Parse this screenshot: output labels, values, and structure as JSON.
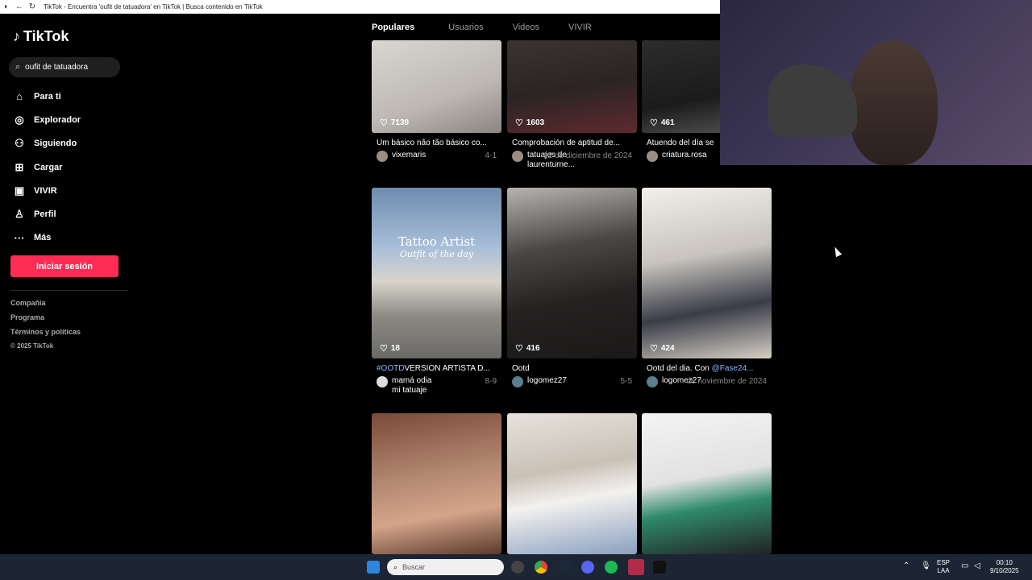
{
  "browser": {
    "title": "TikTok - Encuentra 'oufit de tatuadora' en TikTok | Busca contenido en TikTok"
  },
  "sidebar": {
    "logo": "TikTok",
    "search_value": "oufit de tatuadora",
    "items": [
      {
        "label": "Para ti",
        "icon": "home-icon"
      },
      {
        "label": "Explorador",
        "icon": "compass-icon"
      },
      {
        "label": "Siguiendo",
        "icon": "following-icon"
      },
      {
        "label": "Cargar",
        "icon": "upload-icon"
      },
      {
        "label": "VIVIR",
        "icon": "live-icon"
      },
      {
        "label": "Perfil",
        "icon": "profile-icon"
      },
      {
        "label": "Más",
        "icon": "more-icon"
      }
    ],
    "login_label": "Iniciar sesión",
    "footer": [
      "Compañía",
      "Programa",
      "Términos y políticas",
      "© 2025 TikTok"
    ]
  },
  "tabs": [
    {
      "label": "Populares",
      "active": true
    },
    {
      "label": "Usuarios",
      "active": false
    },
    {
      "label": "Videos",
      "active": false
    },
    {
      "label": "VIVIR",
      "active": false
    }
  ],
  "results": [
    {
      "likes": "7139",
      "caption": "Um básico não tão básico co...",
      "author": "vixemaris",
      "count": "4-1"
    },
    {
      "likes": "1603",
      "caption": "Comprobación de aptitud de...",
      "author": "tatuajes de laurenturne...",
      "date": "12 de diciembre de 2024"
    },
    {
      "likes": "461",
      "caption": "Atuendo del día se",
      "author": "criatura.rosa"
    },
    {
      "likes": "18",
      "hashtag": "#OOTD",
      "caption": "VERSIÓN ARTISTA D...",
      "author": "mamá odia mi tatuaje",
      "count": "8-9"
    },
    {
      "likes": "416",
      "caption": "Ootd",
      "author": "logomez27",
      "count": "5-5"
    },
    {
      "likes": "424",
      "caption": "Ootd del dia. Con ",
      "mention": "@Fase24...",
      "author": "logomez27",
      "date": "de noviembre de 2024"
    },
    {},
    {},
    {}
  ],
  "overlay_text": {
    "tattoo_title": "Tattoo Artist",
    "tattoo_sub": "Outfit of the day",
    "ootd": "OOTD"
  },
  "taskbar": {
    "search_placeholder": "Buscar",
    "lang_top": "ESP",
    "lang_bottom": "LAA",
    "time": "00:10",
    "date": "9/10/2025"
  }
}
